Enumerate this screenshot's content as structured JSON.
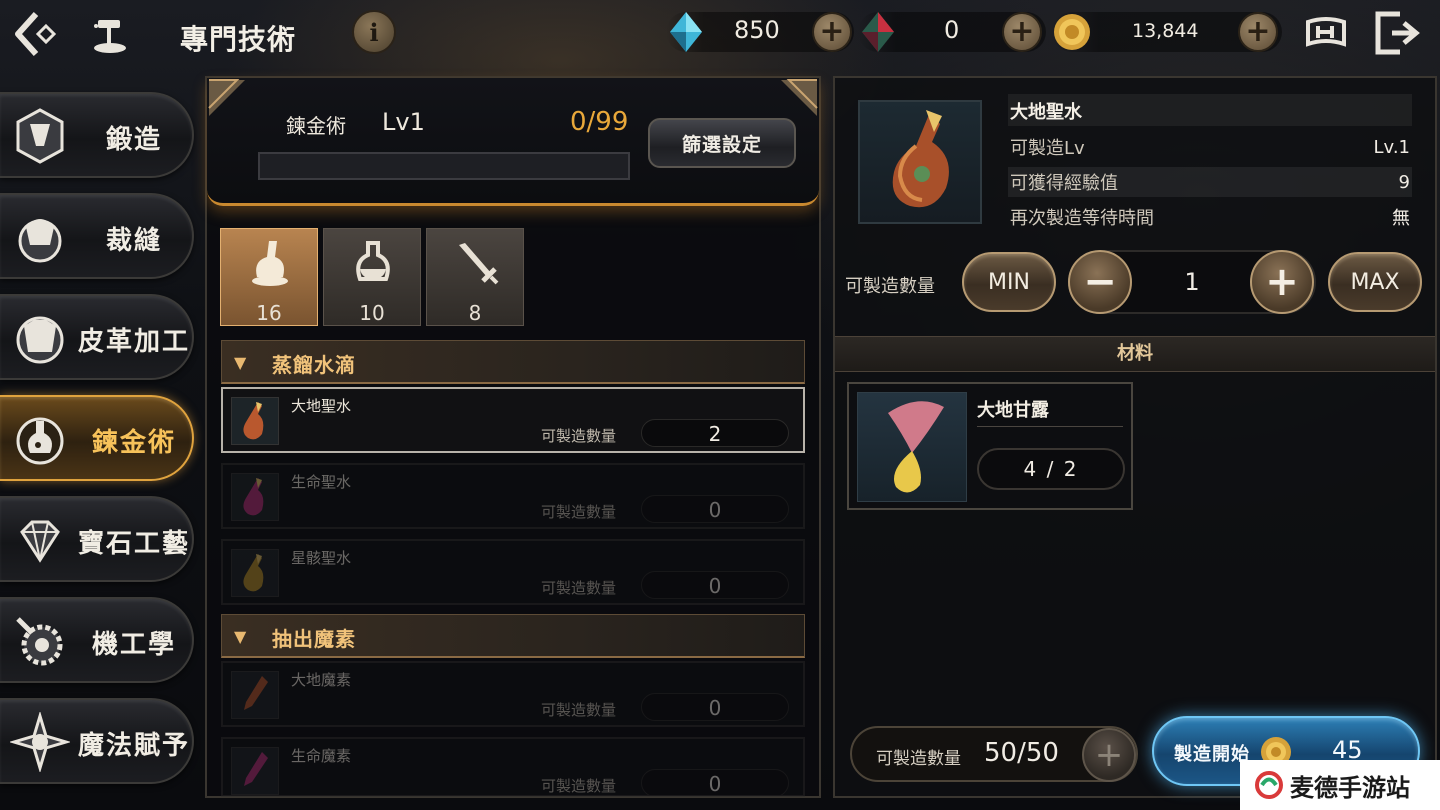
{
  "topbar": {
    "title": "專門技術",
    "info_label": "i",
    "currencies": [
      {
        "icon": "blue-crystal-icon",
        "value": "850"
      },
      {
        "icon": "red-crystal-icon",
        "value": "0"
      },
      {
        "icon": "gold-coin-icon",
        "value": "13,844"
      }
    ],
    "plus_label": "+"
  },
  "nav": {
    "items": [
      {
        "label": "鍛造",
        "icon": "forging-icon"
      },
      {
        "label": "裁縫",
        "icon": "tailoring-icon"
      },
      {
        "label": "皮革加工",
        "icon": "leatherwork-icon"
      },
      {
        "label": "鍊金術",
        "icon": "alchemy-icon",
        "active": true
      },
      {
        "label": "寶石工藝",
        "icon": "gem-craft-icon"
      },
      {
        "label": "機工學",
        "icon": "engineering-icon"
      },
      {
        "label": "魔法賦予",
        "icon": "enchanting-icon"
      }
    ]
  },
  "skill": {
    "name": "鍊金術",
    "level": "Lv1",
    "exp": "0/99",
    "exp_progress": 0,
    "filter_label": "篩選設定"
  },
  "categories": [
    {
      "icon": "mortar-icon",
      "count": "16",
      "active": true
    },
    {
      "icon": "flask-icon",
      "count": "10"
    },
    {
      "icon": "sword-icon",
      "count": "8"
    }
  ],
  "groups": [
    {
      "label": "蒸餾水滴",
      "recipes": [
        {
          "name": "大地聖水",
          "qty_label": "可製造數量",
          "qty": "2",
          "selected": true
        },
        {
          "name": "生命聖水",
          "qty_label": "可製造數量",
          "qty": "0"
        },
        {
          "name": "星骸聖水",
          "qty_label": "可製造數量",
          "qty": "0"
        }
      ]
    },
    {
      "label": "抽出魔素",
      "recipes": [
        {
          "name": "大地魔素",
          "qty_label": "可製造數量",
          "qty": "0"
        },
        {
          "name": "生命魔素",
          "qty_label": "可製造數量",
          "qty": "0"
        }
      ]
    }
  ],
  "detail": {
    "title": "大地聖水",
    "rows": [
      {
        "label": "可製造Lv",
        "value": "Lv.1"
      },
      {
        "label": "可獲得經驗值",
        "value": "9"
      },
      {
        "label": "再次製造等待時間",
        "value": "無"
      }
    ],
    "make_label": "可製造數量",
    "min_label": "MIN",
    "max_label": "MAX",
    "minus_label": "−",
    "plus_label": "+",
    "quantity": "1",
    "materials_header": "材料",
    "materials": [
      {
        "name": "大地甘露",
        "count": "4 / 2"
      }
    ],
    "bottom_qty_label": "可製造數量",
    "bottom_qty_value": "50/50",
    "start_label": "製造開始",
    "start_cost": "45"
  },
  "watermark": {
    "text": "麦德手游站"
  }
}
